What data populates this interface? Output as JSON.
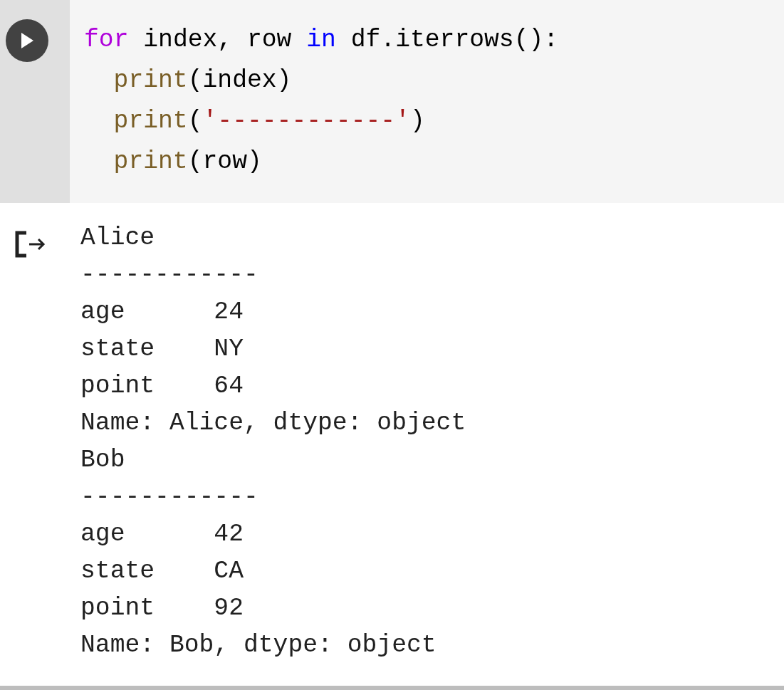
{
  "code_cell": {
    "lines": [
      {
        "tokens": [
          {
            "kind": "keyword",
            "text": "for"
          },
          {
            "kind": "plain",
            "text": " index, row "
          },
          {
            "kind": "builtin",
            "text": "in"
          },
          {
            "kind": "plain",
            "text": " df.iterrows():"
          }
        ],
        "children": [
          {
            "tokens": [
              {
                "kind": "function",
                "text": "print"
              },
              {
                "kind": "plain",
                "text": "(index)"
              }
            ]
          },
          {
            "tokens": [
              {
                "kind": "function",
                "text": "print"
              },
              {
                "kind": "plain",
                "text": "("
              },
              {
                "kind": "string",
                "text": "'------------'"
              },
              {
                "kind": "plain",
                "text": ")"
              }
            ]
          },
          {
            "tokens": [
              {
                "kind": "function",
                "text": "print"
              },
              {
                "kind": "plain",
                "text": "(row)"
              }
            ]
          }
        ]
      }
    ]
  },
  "output": {
    "lines": [
      "Alice",
      "------------",
      "age      24",
      "state    NY",
      "point    64",
      "Name: Alice, dtype: object",
      "Bob",
      "------------",
      "age      42",
      "state    CA",
      "point    92",
      "Name: Bob, dtype: object"
    ]
  }
}
